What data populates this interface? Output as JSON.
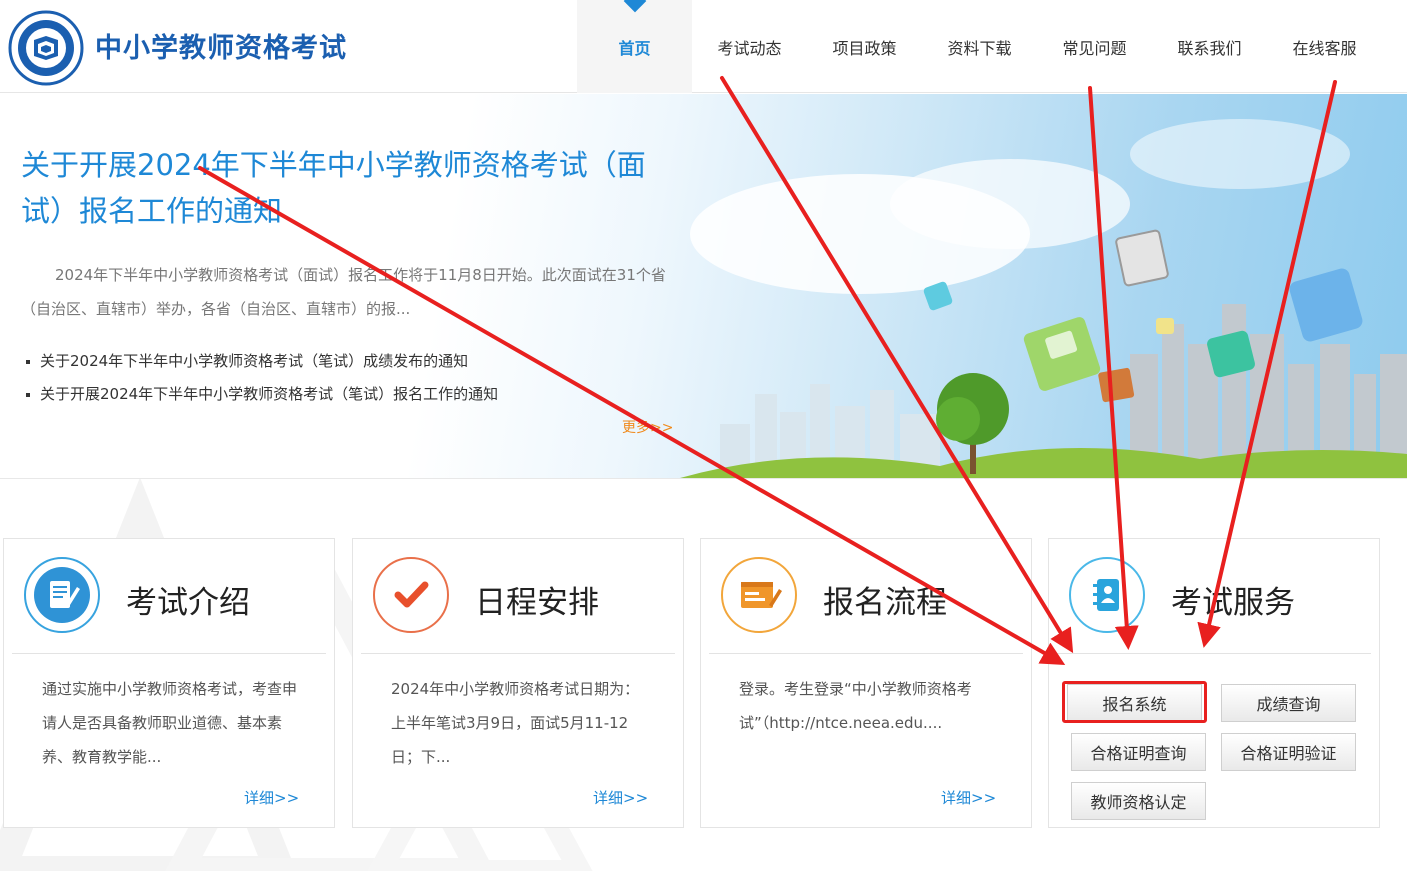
{
  "header": {
    "site_title": "中小学教师资格考试",
    "nav": [
      "首页",
      "考试动态",
      "项目政策",
      "资料下载",
      "常见问题",
      "联系我们",
      "在线客服"
    ]
  },
  "banner": {
    "headline": "关于开展2024年下半年中小学教师资格考试（面试）报名工作的通知",
    "summary": "2024年下半年中小学教师资格考试（面试）报名工作将于11月8日开始。此次面试在31个省（自治区、直辖市）举办，各省（自治区、直辖市）的报...",
    "news": [
      "关于2024年下半年中小学教师资格考试（笔试）成绩发布的通知",
      "关于开展2024年下半年中小学教师资格考试（笔试）报名工作的通知"
    ],
    "more": "更多>>"
  },
  "cards": [
    {
      "icon": "exam-intro-icon",
      "title": "考试介绍",
      "text": "通过实施中小学教师资格考试，考查申请人是否具备教师职业道德、基本素养、教育教学能...",
      "detail": "详细>>"
    },
    {
      "icon": "check-icon",
      "title": "日程安排",
      "text": "2024年中小学教师资格考试日期为：上半年笔试3月9日，面试5月11-12日；下...",
      "detail": "详细>>"
    },
    {
      "icon": "registration-form-icon",
      "title": "报名流程",
      "text": "登录。考生登录“中小学教师资格考试”（http://ntce.neea.edu....",
      "detail": "详细>>"
    },
    {
      "icon": "contact-book-icon",
      "title": "考试服务"
    }
  ],
  "services": [
    "报名系统",
    "成绩查询",
    "合格证明查询",
    "合格证明验证",
    "教师资格认定"
  ],
  "colors": {
    "brand_blue": "#1b5fb0",
    "accent_blue": "#1e88d6",
    "orange": "#f08a1c",
    "highlight_red": "#e8201f"
  }
}
